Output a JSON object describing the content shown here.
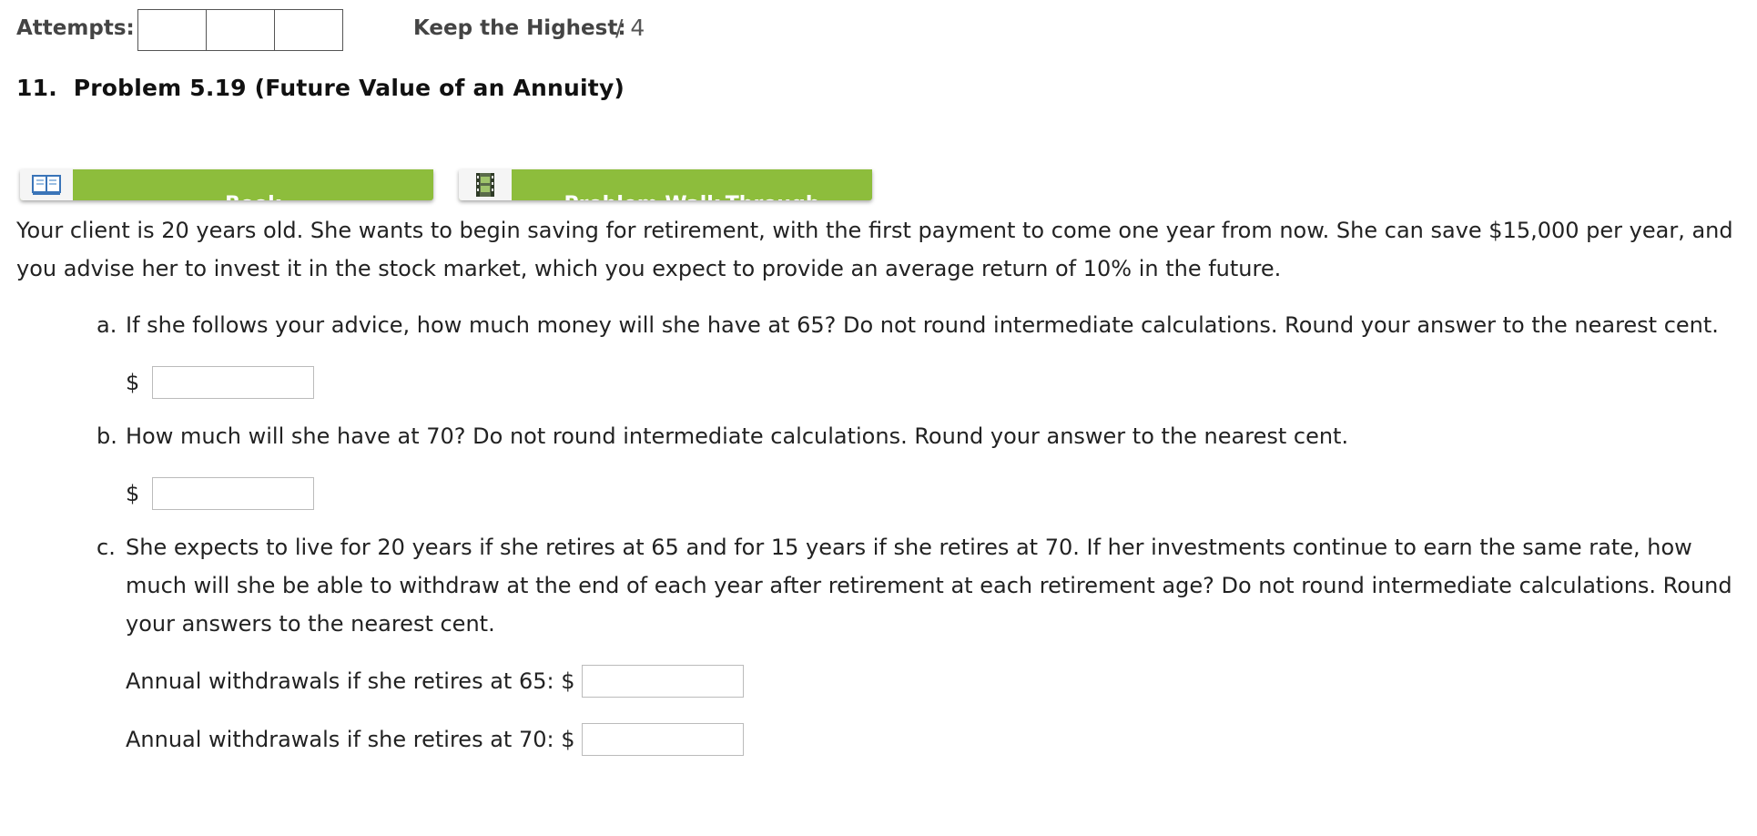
{
  "header": {
    "attempts_label": "Attempts:",
    "attempt_slots": 3,
    "keep_label": "Keep the Highest:",
    "score": "/ 4"
  },
  "problem": {
    "title": "11.  Problem 5.19 (Future Value of an Annuity)"
  },
  "resources": {
    "book_label": "Book",
    "book_icon": "book-icon",
    "video_label": "Problem Walk-Through",
    "video_icon": "film-icon",
    "accent_color": "#8dbd3c"
  },
  "content": {
    "intro": "Your client is 20 years old. She wants to begin saving for retirement, with the first payment to come one year from now. She can save $15,000 per year, and you advise her to invest it in the stock market, which you expect to provide an average return of 10% in the future.",
    "questions": [
      {
        "letter": "a.",
        "text": "If she follows your advice, how much money will she have at 65? Do not round intermediate calculations. Round your answer to the nearest cent.",
        "currency": "$",
        "value": ""
      },
      {
        "letter": "b.",
        "text": "How much will she have at 70? Do not round intermediate calculations. Round your answer to the nearest cent.",
        "currency": "$",
        "value": ""
      },
      {
        "letter": "c.",
        "text": "She expects to live for 20 years if she retires at 65 and for 15 years if she retires at 70. If her investments continue to earn the same rate, how much will she be able to withdraw at the end of each year after retirement at each retirement age? Do not round intermediate calculations. Round your answers to the nearest cent."
      }
    ],
    "withdrawals": [
      {
        "label": "Annual withdrawals if she retires at 65: $",
        "value": ""
      },
      {
        "label": "Annual withdrawals if she retires at 70: $",
        "value": ""
      }
    ]
  }
}
